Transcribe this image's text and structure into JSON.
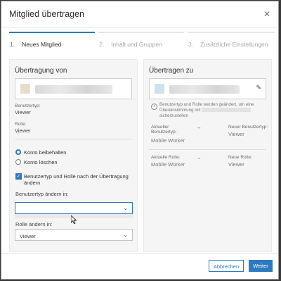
{
  "dialog": {
    "title": "Mitglied übertragen",
    "close_icon": "close-icon"
  },
  "steps": [
    {
      "num": "1.",
      "label": "Neues Mitglied",
      "active": true
    },
    {
      "num": "2.",
      "label": "Inhalt und Gruppen",
      "active": false
    },
    {
      "num": "3.",
      "label": "Zusätzliche Einstellungen",
      "active": false
    }
  ],
  "left": {
    "title": "Übertragung von",
    "user_type_label": "Benutzertyp:",
    "user_type_value": "Viewer",
    "role_label": "Rolle:",
    "role_value": "Viewer",
    "radio_keep": "Konto beibehalten",
    "radio_delete": "Konto löschen",
    "checkbox_label": "Benutzertyp und Rolle nach der Übertragung ändern",
    "change_type_label": "Benutzertyp ändern in:",
    "change_type_value": "",
    "change_role_label": "Rolle ändern in:",
    "change_role_value": "Viewer"
  },
  "right": {
    "title": "Übertragen zu",
    "note": "Benutzertyp und Rolle werden geändert, um eine Übereinstimmung mit",
    "note_end": "sicherzustellen",
    "current_type_label": "Aktueller Benutzertyp:",
    "current_type_value": "Mobile Worker",
    "new_type_label": "Neuer Benutzertyp:",
    "new_type_value": "Viewer",
    "current_role_label": "Aktuelle Rolle:",
    "current_role_value": "Mobile Worker",
    "new_role_label": "Neue Rolle:",
    "new_role_value": "Viewer",
    "arrow": "→"
  },
  "footer": {
    "cancel": "Abbrechen",
    "next": "Weiter"
  },
  "colors": {
    "accent": "#2c7bbf",
    "panel_bg": "#f5f5f5"
  }
}
